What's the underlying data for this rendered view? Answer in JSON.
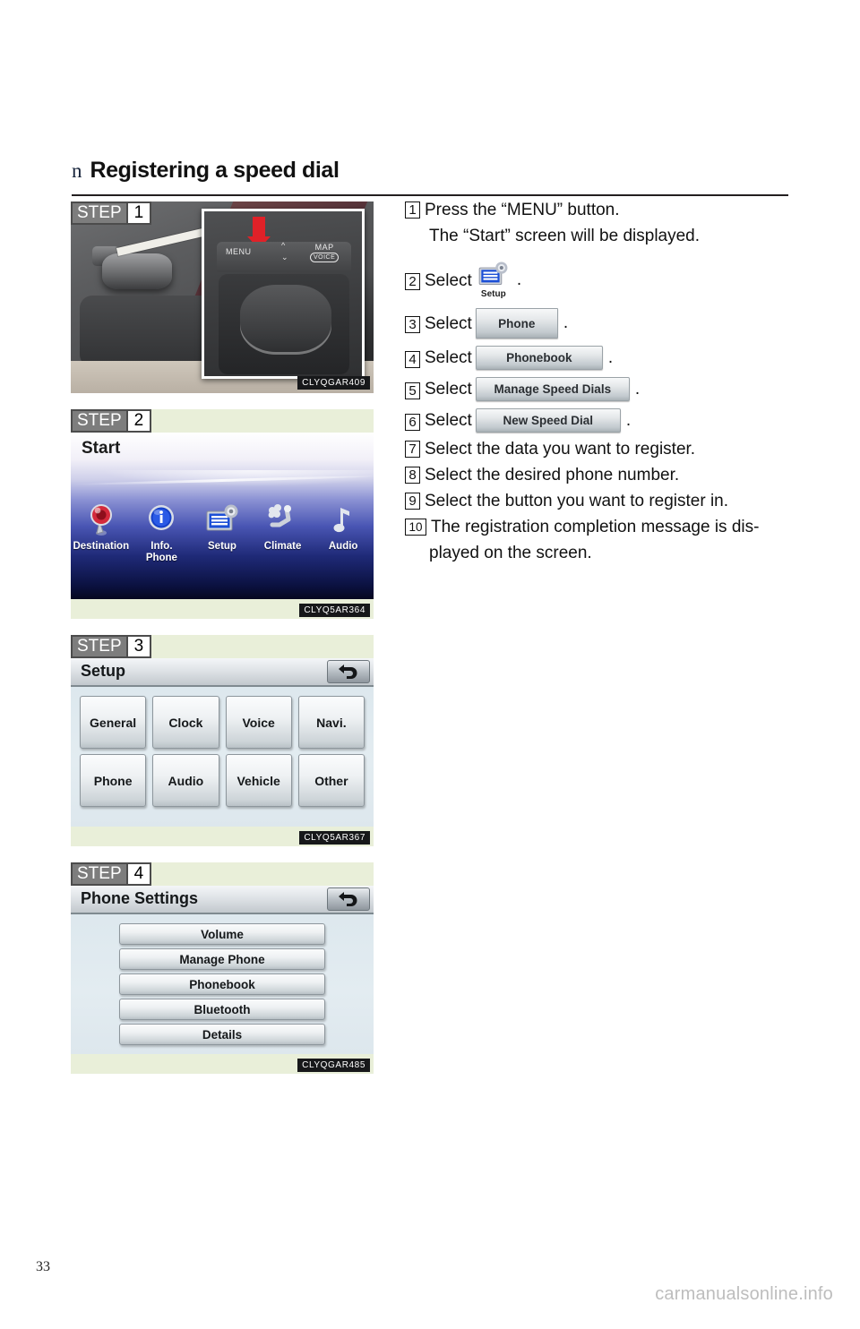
{
  "header": {
    "bullet": "n",
    "title": "Registering a speed dial"
  },
  "left_panels": [
    {
      "step_word": "STEP",
      "step_num": "1",
      "type": "photo",
      "caption": "CLYQGAR409",
      "labels": {
        "menu": "MENU",
        "map": "MAP",
        "map_sub": "VOICE"
      }
    },
    {
      "step_word": "STEP",
      "step_num": "2",
      "type": "start-screen",
      "title": "Start",
      "caption": "CLYQ5AR364",
      "icons": [
        {
          "label": "Destination",
          "icon": "map-pin-icon"
        },
        {
          "label": "Info.\nPhone",
          "icon": "information-icon"
        },
        {
          "label": "Setup",
          "icon": "setup-gear-icon"
        },
        {
          "label": "Climate",
          "icon": "climate-seat-icon"
        },
        {
          "label": "Audio",
          "icon": "music-note-icon"
        }
      ]
    },
    {
      "step_word": "STEP",
      "step_num": "3",
      "type": "grid-screen",
      "title": "Setup",
      "caption": "CLYQ5AR367",
      "back_icon": "back-arrow-icon",
      "buttons": [
        "General",
        "Clock",
        "Voice",
        "Navi.",
        "Phone",
        "Audio",
        "Vehicle",
        "Other"
      ]
    },
    {
      "step_word": "STEP",
      "step_num": "4",
      "type": "list-screen",
      "title": "Phone Settings",
      "caption": "CLYQGAR485",
      "back_icon": "back-arrow-icon",
      "buttons": [
        "Volume",
        "Manage Phone",
        "Phonebook",
        "Bluetooth",
        "Details"
      ]
    }
  ],
  "steps": [
    {
      "num": "1",
      "text": "Press the “MENU” button.",
      "sub": "The “Start” screen will be displayed."
    },
    {
      "num": "2",
      "text": "Select",
      "button": "Setup",
      "button_kind": "icon",
      "period": "."
    },
    {
      "num": "3",
      "text": "Select",
      "button": "Phone",
      "button_kind": "tall",
      "period": "."
    },
    {
      "num": "4",
      "text": "Select",
      "button": "Phonebook",
      "button_kind": "inline",
      "period": "."
    },
    {
      "num": "5",
      "text": "Select",
      "button": "Manage Speed Dials",
      "button_kind": "inline",
      "period": "."
    },
    {
      "num": "6",
      "text": "Select",
      "button": "New Speed Dial",
      "button_kind": "inline",
      "period": "."
    },
    {
      "num": "7",
      "text": "Select the data you want to register."
    },
    {
      "num": "8",
      "text": "Select the desired phone number."
    },
    {
      "num": "9",
      "text": "Select the button you want to register in."
    },
    {
      "num": "10",
      "text": "The registration completion message is dis-",
      "sub": "played on the screen."
    }
  ],
  "footer": {
    "page_number": "33",
    "watermark": "carmanualsonline.info"
  },
  "colors": {
    "panel_bg": "#e9efd9",
    "step_badge_bg": "#7d7d7d",
    "accent_red": "#e02128",
    "rule": "#231f20"
  }
}
